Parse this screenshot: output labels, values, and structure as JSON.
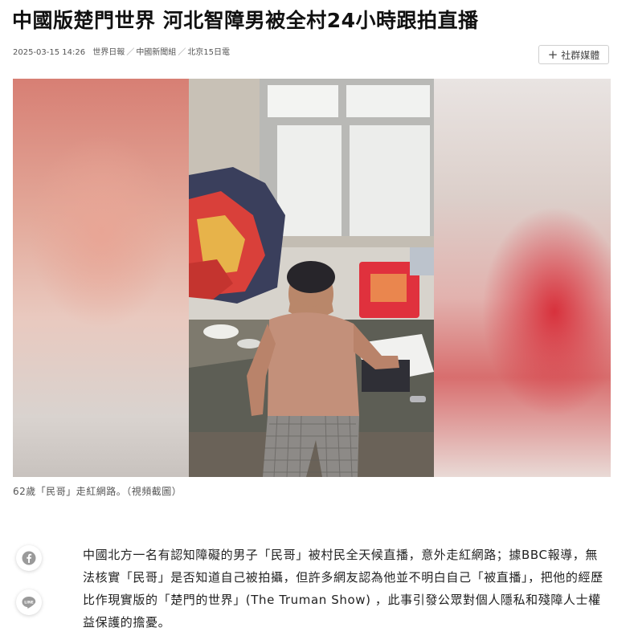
{
  "article": {
    "headline": "中國版楚門世界 河北智障男被全村24小時跟拍直播",
    "date": "2025-03-15 14:26",
    "source": "世界日報",
    "desk": "中國新聞組",
    "dateline": "北京15日電",
    "social_button_label": "社群媒體",
    "photo_caption": "62歲「民哥」走紅網路。（視頻截圖）",
    "body": "中國北方一名有認知障礙的男子「民哥」被村民全天候直播，意外走紅網路；據BBC報導，無法核實「民哥」是否知道自己被拍攝，但許多網友認為他並不明白自己「被直播」，把他的經歷比作現實版的「楚門的世界」(The Truman Show) ，此事引發公眾對個人隱私和殘障人士權益保護的擔憂。"
  },
  "share_buttons": [
    {
      "icon": "facebook-icon"
    },
    {
      "icon": "line-icon"
    }
  ],
  "colors": {
    "facebook_gray": "#9a9a9a",
    "line_gray": "#9a9a9a",
    "text": "#222222"
  }
}
